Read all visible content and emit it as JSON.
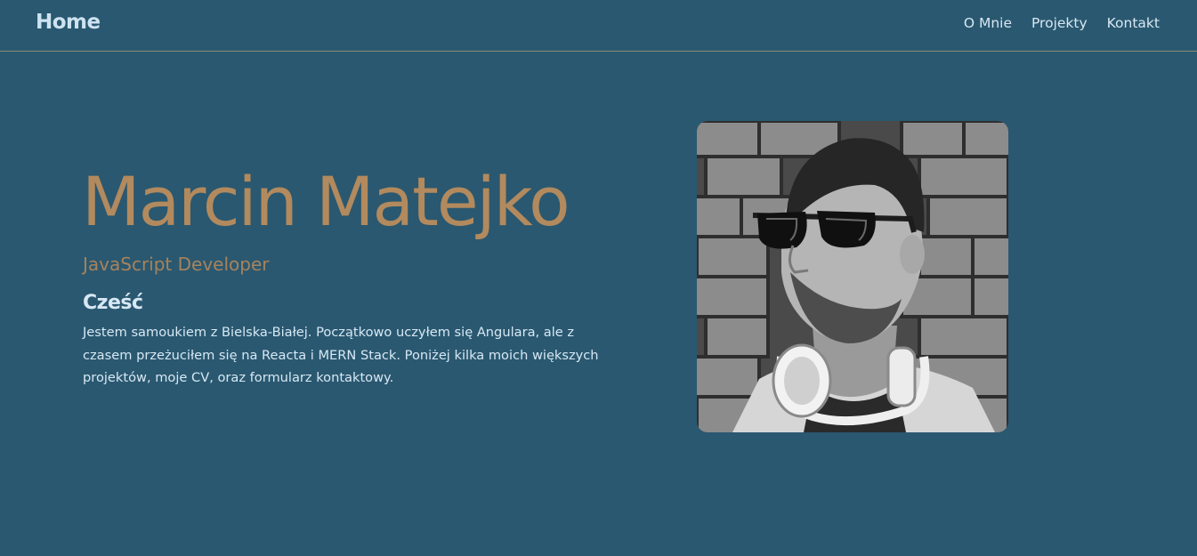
{
  "navbar": {
    "brand": "Home",
    "links": [
      {
        "label": "O Mnie"
      },
      {
        "label": "Projekty"
      },
      {
        "label": "Kontakt"
      }
    ]
  },
  "hero": {
    "name": "Marcin Matejko",
    "role": "JavaScript Developer",
    "greeting": "Cześć",
    "bio": "Jestem samoukiem z Bielska-Białej. Początkowo uczyłem się Angulara, ale z czasem przeżuciłem się na Reacta i MERN Stack. Poniżej kilka moich większych projektów, moje CV, oraz formularz kontaktowy."
  },
  "colors": {
    "background": "#2a5870",
    "accent": "#b28a5e",
    "text_light": "#d7e8f4"
  }
}
